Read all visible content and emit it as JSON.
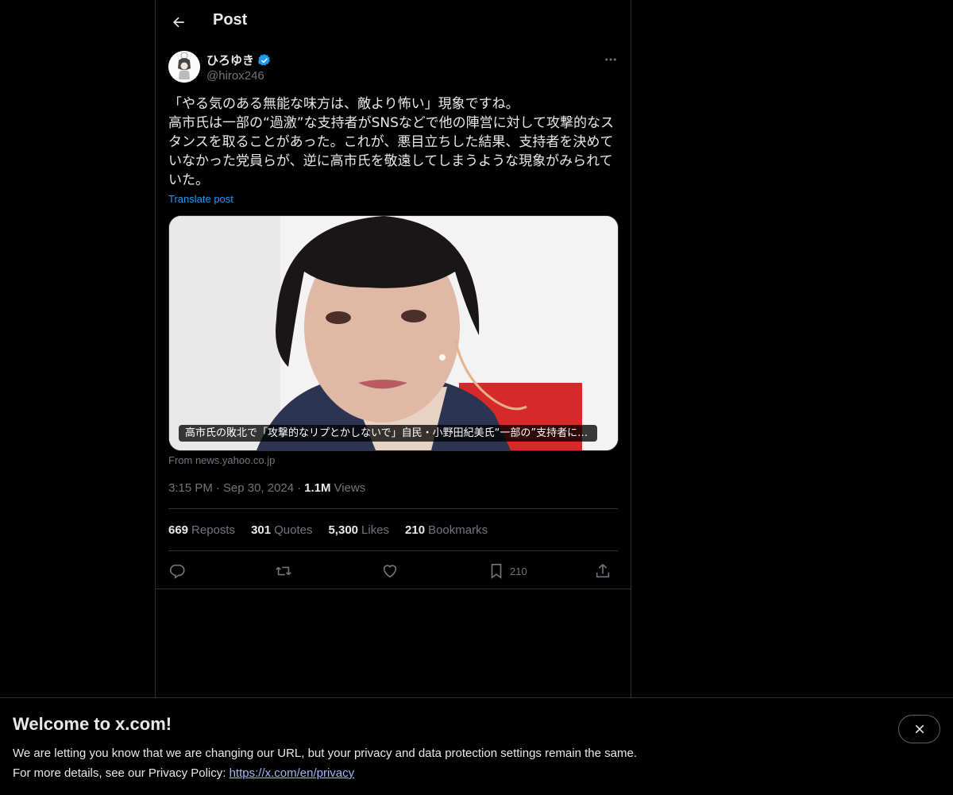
{
  "header": {
    "title": "Post"
  },
  "author": {
    "display_name": "ひろゆき",
    "handle": "@hirox246",
    "verified": true
  },
  "post": {
    "text": "「やる気のある無能な味方は、敵より怖い」現象ですね。\n高市氏は一部の“過激”な支持者がSNSなどで他の陣営に対して攻撃的なスタンスを取ることがあった。これが、悪目立ちした結果、支持者を決めていなかった党員らが、逆に高市氏を敬遠してしまうような現象がみられていた。",
    "translate_label": "Translate post"
  },
  "card": {
    "caption": "高市氏の敗北で「攻撃的なリプとかしないで」自民・小野田紀美氏“一部の”支持者にお…",
    "source": "From news.yahoo.co.jp"
  },
  "meta": {
    "time": "3:15 PM",
    "date": "Sep 30, 2024",
    "views_count": "1.1M",
    "views_label": "Views",
    "sep": "·"
  },
  "stats": {
    "reposts_count": "669",
    "reposts_label": "Reposts",
    "quotes_count": "301",
    "quotes_label": "Quotes",
    "likes_count": "5,300",
    "likes_label": "Likes",
    "bookmarks_count": "210",
    "bookmarks_label": "Bookmarks"
  },
  "actions": {
    "bookmark_count": "210"
  },
  "banner": {
    "title": "Welcome to x.com!",
    "line1": "We are letting you know that we are changing our URL, but your privacy and data protection settings remain the same.",
    "line2_prefix": "For more details, see our Privacy Policy: ",
    "link": "https://x.com/en/privacy"
  },
  "colors": {
    "accent": "#1d9bf0",
    "muted": "#71767b",
    "border": "#2f3336",
    "text": "#e7e9ea"
  },
  "icons": [
    "back-arrow-icon",
    "verified-badge-icon",
    "more-icon",
    "reply-icon",
    "repost-icon",
    "like-icon",
    "bookmark-icon",
    "share-icon",
    "close-icon"
  ]
}
